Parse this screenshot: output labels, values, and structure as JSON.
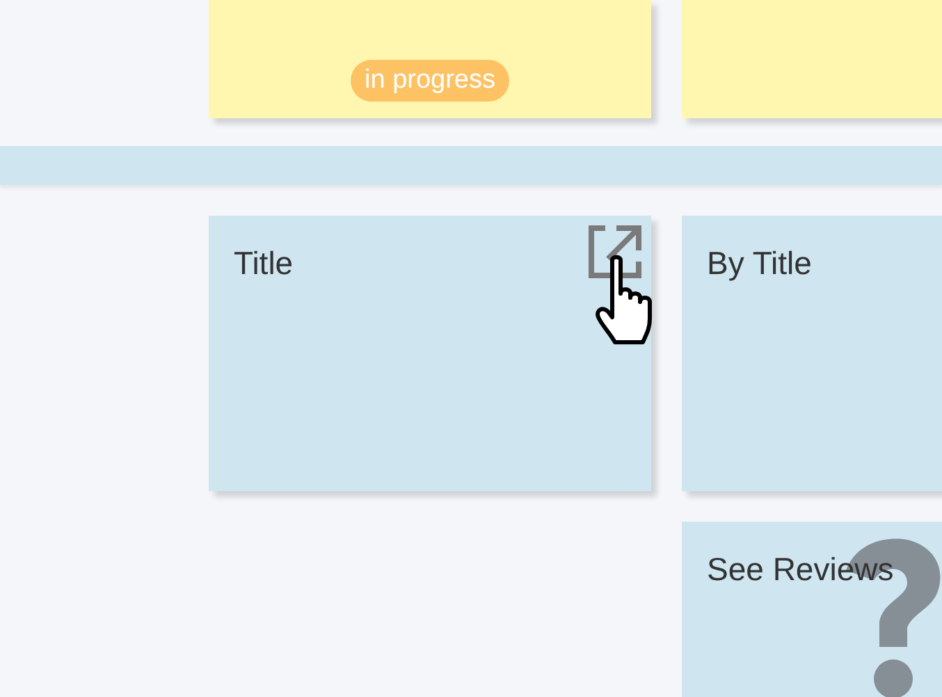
{
  "release_cards": [
    {
      "kind": "status",
      "badge": "in progress"
    },
    {
      "kind": "blank"
    }
  ],
  "columns": [
    [
      {
        "kind": "hovered",
        "title": "Title"
      }
    ],
    [
      {
        "kind": "plain",
        "title": "By Title"
      },
      {
        "kind": "plain",
        "title": "See Reviews"
      }
    ]
  ]
}
